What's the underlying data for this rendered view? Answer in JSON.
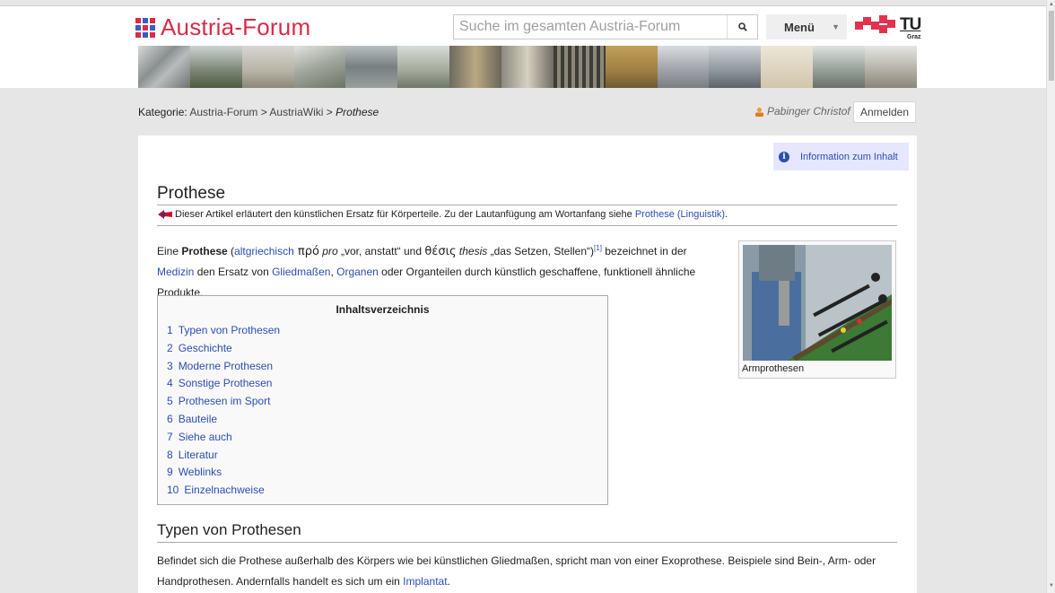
{
  "header": {
    "logo_text": "Austria-Forum",
    "search_placeholder": "Suche im gesamten Austria-Forum",
    "menu_label": "Menü",
    "tu_text": "TU",
    "tu_sub": "Graz"
  },
  "breadcrumb": {
    "label": "Kategorie:",
    "items": [
      "Austria-Forum",
      "AustriaWiki"
    ],
    "separator": ">",
    "current": "Prothese"
  },
  "user": {
    "name": "Pabinger Christof",
    "login_label": "Anmelden"
  },
  "info_box": {
    "label": "Information zum Inhalt"
  },
  "article": {
    "title": "Prothese",
    "hatnote_text": "Dieser Artikel erläutert den künstlichen Ersatz für Körperteile. Zu der Lautanfügung am Wortanfang siehe",
    "hatnote_link": "Prothese (Linguistik)",
    "hatnote_end": ".",
    "intro": {
      "t1": "Eine ",
      "bold": "Prothese",
      "t2": " (",
      "link1": "altgriechisch",
      "greek1": " πρό",
      "italic1": " pro",
      "t3": " „vor, anstatt“ und ",
      "greek2": "θέσις",
      "italic2": " thesis",
      "t4": " „das Setzen, Stellen“)",
      "ref": "[1]",
      "t5": " bezeichnet in der",
      "link2": "Medizin",
      "t6": " den Ersatz von ",
      "link3": "Gliedmaßen",
      "t7": ", ",
      "link4": "Organen",
      "t8": " oder Organteilen durch künstlich geschaffene, funktionell ähnliche",
      "t9": "Produkte."
    },
    "toc": {
      "title": "Inhaltsverzeichnis",
      "items": [
        {
          "num": "1",
          "label": "Typen von Prothesen"
        },
        {
          "num": "2",
          "label": "Geschichte"
        },
        {
          "num": "3",
          "label": "Moderne Prothesen"
        },
        {
          "num": "4",
          "label": "Sonstige Prothesen"
        },
        {
          "num": "5",
          "label": "Prothesen im Sport"
        },
        {
          "num": "6",
          "label": "Bauteile"
        },
        {
          "num": "7",
          "label": "Siehe auch"
        },
        {
          "num": "8",
          "label": "Literatur"
        },
        {
          "num": "9",
          "label": "Weblinks"
        },
        {
          "num": "10",
          "label": "Einzelnachweise"
        }
      ]
    },
    "thumb_caption": "Armprothesen",
    "section1_title": "Typen von Prothesen",
    "section1": {
      "t1": "Befindet sich die Prothese außerhalb des Körpers wie bei künstlichen Gliedmaßen, spricht man von einer Exoprothese. Beispiele sind Bein-, Arm- oder",
      "t2": "Handprothesen. Andernfalls handelt es sich um ein ",
      "link": "Implantat",
      "t3": "."
    }
  },
  "colors": {
    "brand_red": "#d92b4a",
    "link_blue": "#2a4eb4",
    "info_bg": "#e6e6ff"
  }
}
